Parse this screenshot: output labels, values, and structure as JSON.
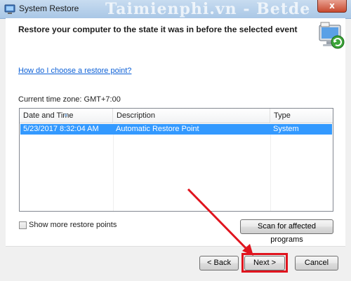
{
  "window": {
    "title": "System Restore",
    "watermark": "Taimienphi.vn - Betde",
    "close_glyph": "x"
  },
  "header": {
    "heading": "Restore your computer to the state it was in before the selected event",
    "icon": "system-restore-icon"
  },
  "content": {
    "help_link": "How do I choose a restore point?",
    "timezone": "Current time zone: GMT+7:00",
    "table": {
      "columns": [
        "Date and Time",
        "Description",
        "Type"
      ],
      "rows": [
        {
          "date": "5/23/2017 8:32:04 AM",
          "description": "Automatic Restore Point",
          "type": "System",
          "selected": true
        }
      ]
    },
    "show_more_label": "Show more restore points",
    "show_more_checked": false,
    "scan_button": "Scan for affected programs"
  },
  "footer": {
    "back_button": "< Back",
    "next_button": "Next >",
    "cancel_button": "Cancel"
  },
  "colors": {
    "selection": "#3399ff",
    "link": "#0b5fd6",
    "annotation": "#e0141e"
  }
}
